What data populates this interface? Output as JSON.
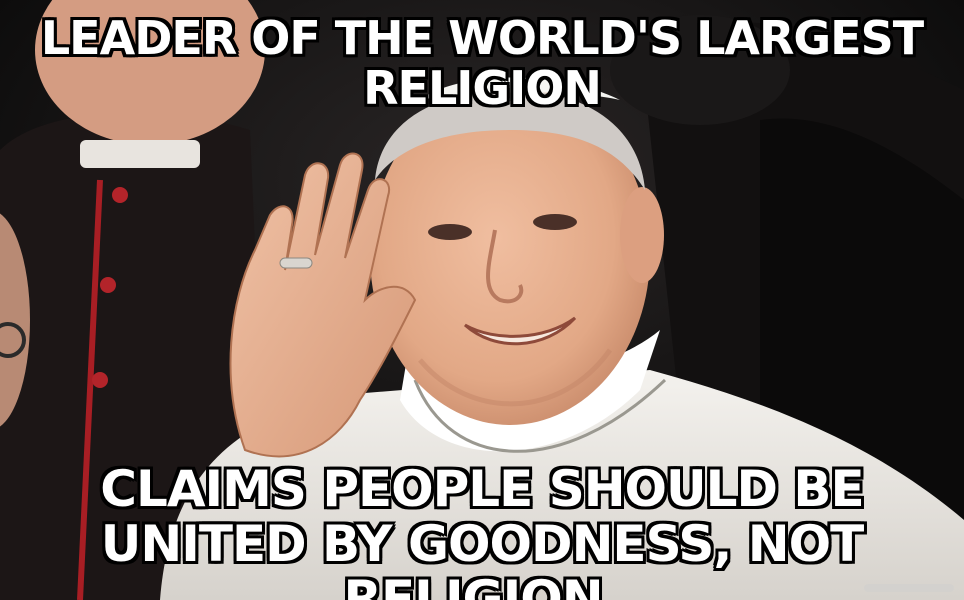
{
  "meme": {
    "top_text": "LEADER OF THE WORLD'S LARGEST RELIGION",
    "bottom_text": "CLAIMS PEOPLE SHOULD BE UNITED BY GOODNESS, NOT RELIGION."
  },
  "colors": {
    "caption_fill": "#ffffff",
    "caption_outline": "#000000",
    "background_dark": "#0d0d0d",
    "robe_white": "#eceae6",
    "cassock_black": "#1c1616",
    "piping_red": "#a81e24",
    "skin": "#e4ae8f"
  },
  "icons": {
    "watermark": "imgflip-watermark-icon"
  }
}
